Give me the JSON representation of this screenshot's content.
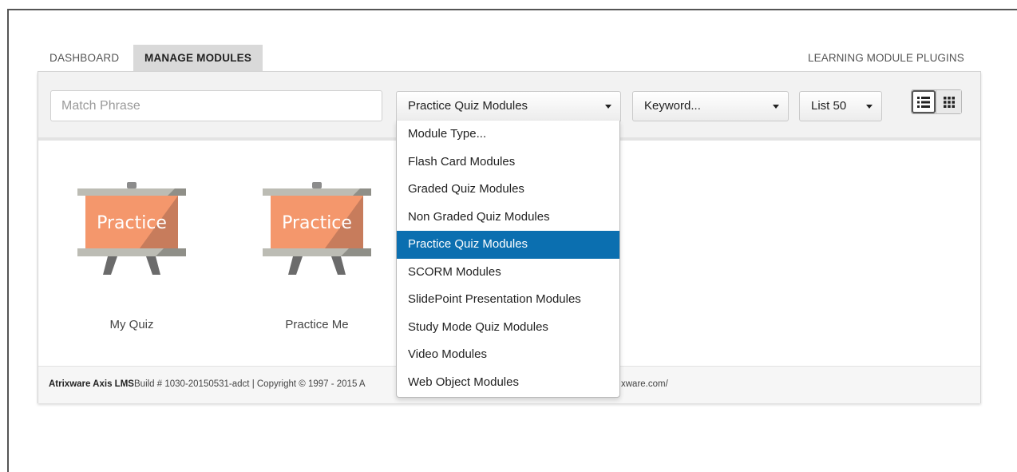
{
  "nav": {
    "dashboard": "DASHBOARD",
    "manage_modules": "MANAGE MODULES",
    "plugins": "LEARNING MODULE PLUGINS"
  },
  "toolbar": {
    "search_placeholder": "Match Phrase",
    "module_type_selected": "Practice Quiz Modules",
    "keyword_selected": "Keyword...",
    "list_selected": "List 50",
    "view_list_icon": "list-view-icon",
    "view_grid_icon": "grid-view-icon"
  },
  "modules": [
    {
      "thumbnail_text": "Practice",
      "label": "My Quiz"
    },
    {
      "thumbnail_text": "Practice",
      "label": "Practice Me"
    }
  ],
  "dropdown": {
    "items": [
      "Module Type...",
      "Flash Card Modules",
      "Graded Quiz Modules",
      "Non Graded Quiz Modules",
      "Practice Quiz Modules",
      "SCORM Modules",
      "SlidePoint Presentation Modules",
      "Study Mode Quiz Modules",
      "Video Modules",
      "Web Object Modules"
    ],
    "selected_index": 4
  },
  "footer": {
    "brand": "Atrixware Axis LMS",
    "build": "Build # 1030-20150531-adct | Copyright © 1997 - 2015 A",
    "url_fragment": "xware.com/"
  },
  "colors": {
    "accent": "#0b6fb0",
    "thumbnail": "#f4976c"
  }
}
